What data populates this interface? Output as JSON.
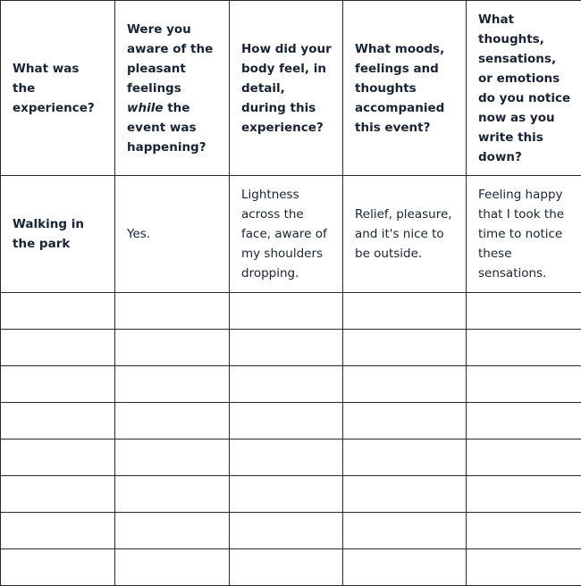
{
  "table": {
    "headers": [
      {
        "before": "What was the experience?",
        "italic": "",
        "after": ""
      },
      {
        "before": "Were you aware of the pleasant feelings ",
        "italic": "while",
        "after": " the event was happening?"
      },
      {
        "before": "How did your body feel, in detail, during this experience?",
        "italic": "",
        "after": ""
      },
      {
        "before": "What moods, feelings and thoughts accompanied this event?",
        "italic": "",
        "after": ""
      },
      {
        "before": "What thoughts, sensations, or emotions do you notice now as you write this down?",
        "italic": "",
        "after": ""
      }
    ],
    "example_row": [
      "Walking in the park",
      "Yes.",
      "Lightness across the face, aware of my shoulders dropping.",
      "Relief, pleasure, and it's nice to be outside.",
      "Feeling happy that I took the time to notice these sensations."
    ],
    "blank_row_count": 8
  }
}
